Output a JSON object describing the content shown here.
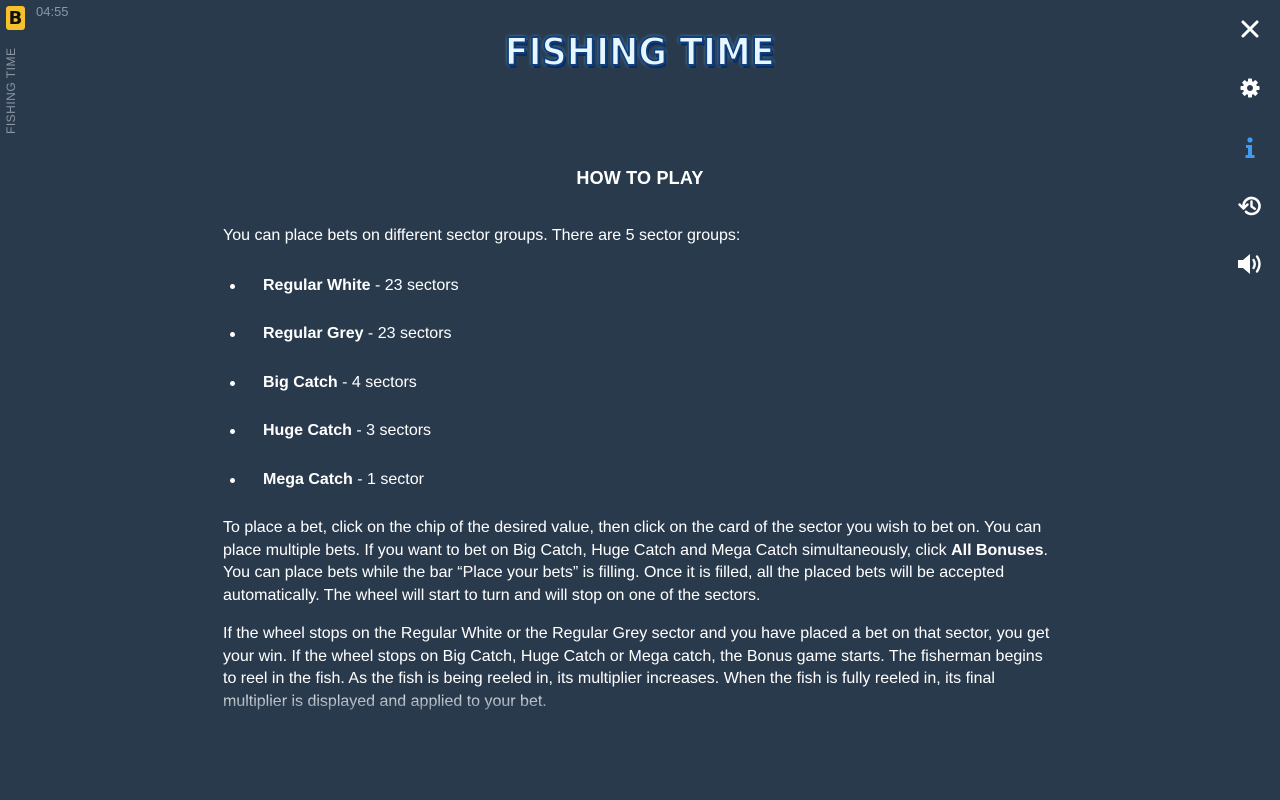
{
  "header": {
    "badge_letter": "B",
    "clock": "04:55",
    "side_title": "FISHING TIME",
    "logo_text": "FISHING TIME"
  },
  "rail": {
    "close_icon": "close-icon",
    "settings_icon": "gear-icon",
    "info_icon": "info-icon",
    "history_icon": "history-icon",
    "sound_icon": "speaker-icon",
    "active_color": "#3d9bf5"
  },
  "rules": {
    "title": "HOW TO PLAY",
    "intro": "You can place bets on different sector groups. There are 5 sector groups:",
    "groups": [
      {
        "name": "Regular White",
        "count": " - 23 sectors"
      },
      {
        "name": "Regular Grey",
        "count": " - 23 sectors"
      },
      {
        "name": "Big Catch",
        "count": " - 4 sectors"
      },
      {
        "name": "Huge Catch",
        "count": " - 3 sectors"
      },
      {
        "name": "Mega Catch",
        "count": " - 1 sector"
      }
    ],
    "p2_part1": "To place a bet, click on the chip of the desired value, then click on the card of the sector you wish to bet on. You can place multiple bets. If you want to bet on Big Catch, Huge Catch and Mega Catch simultaneously, click ",
    "p2_bold": "All Bonuses",
    "p2_part2": ". You can place bets while the bar “Place your bets” is filling. Once it is filled, all the placed bets will be accepted automatically. The wheel will start to turn and will stop on one of the sectors.",
    "p3": "If the wheel stops on the Regular White or the Regular Grey sector and you have placed a bet on that sector, you get your win. If the wheel stops on Big Catch, Huge Catch or Mega catch, the Bonus game starts. The fisherman begins to reel in the fish. As the fish is being reeled in, its multiplier increases. When the fish is fully reeled in, its final multiplier is displayed and applied to your bet."
  }
}
